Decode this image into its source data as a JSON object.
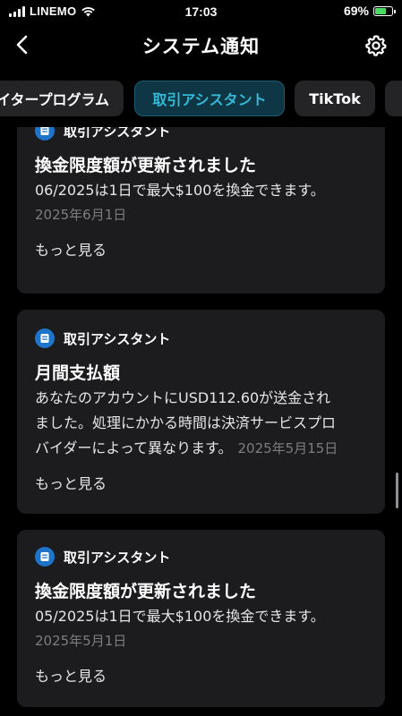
{
  "status_bar": {
    "carrier": "LINEMO",
    "time": "17:03",
    "battery": "69%",
    "battery_level": 0.69
  },
  "header": {
    "title": "システム通知"
  },
  "tabs": [
    {
      "label": "イタープログラム",
      "active": false
    },
    {
      "label": "取引アシスタント",
      "active": true
    },
    {
      "label": "TikTok",
      "active": false
    },
    {
      "label": "",
      "active": false
    }
  ],
  "notifications": [
    {
      "sender": "取引アシスタント",
      "title": "換金限度額が更新されました",
      "body": "06/2025は1日で最大$100を換金できます。",
      "date": "2025年6月1日",
      "more": "もっと見る"
    },
    {
      "sender": "取引アシスタント",
      "title": "月間支払額",
      "body_lines": [
        "あなたのアカウントにUSD112.60が送金され",
        "ました。処理にかかる時間は決済サービスプロ",
        "バイダーによって異なります。"
      ],
      "date": "2025年5月15日",
      "more": "もっと見る"
    },
    {
      "sender": "取引アシスタント",
      "title": "換金限度額が更新されました",
      "body": "05/2025は1日で最大$100を換金できます。",
      "date": "2025年5月1日",
      "more": "もっと見る"
    }
  ],
  "colors": {
    "active_tab_bg": "#0f3644",
    "active_tab_text": "#35b9d6",
    "card_bg": "#1c1c1e",
    "icon_blue": "#1d74c9",
    "battery_green": "#4cd964"
  }
}
